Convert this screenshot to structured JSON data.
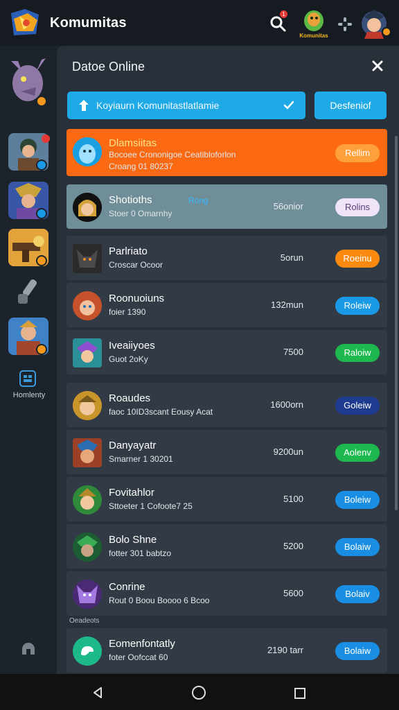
{
  "header": {
    "title": "Komumitas",
    "notification_count": "1",
    "game_logo_text": "Komunitas"
  },
  "sidebar": {
    "label": "Homlenty"
  },
  "panel": {
    "title": "Datoe Online",
    "search_text": "Koyiaurn Komunitastlatlamie",
    "search_button": "Desfeniof"
  },
  "rows": [
    {
      "name": "Dlamsiitas",
      "sub": "Bocoee Crononigoe Ceatibloforlon",
      "sub2": "Croang 01 80237",
      "meta": "",
      "button": "Rellim",
      "button_color": "#ffa13a"
    },
    {
      "name": "Shotioths",
      "sub": "Stoer 0 Omarnhy",
      "tag": "Rong",
      "meta": "56onior",
      "button": "Rolins",
      "button_color": "#efe3f7"
    },
    {
      "name": "Parlriato",
      "sub": "Croscar Ocoor",
      "meta": "5orun",
      "button": "Roeinu",
      "button_color": "#fb8a10"
    },
    {
      "name": "Roonuoiuns",
      "sub": "foier 1390",
      "meta": "132mun",
      "button": "Roleiw",
      "button_color": "#1a9ae6"
    },
    {
      "name": "Iveaiiyoes",
      "sub": "Guot 2oKy",
      "meta": "7500",
      "button": "Raloiw",
      "button_color": "#1db94f"
    },
    {
      "name": "Roaudes",
      "sub": "faoc 10ID3scant Eousy Acat",
      "meta": "1600orn",
      "button": "Goleiw",
      "button_color": "#1e3c8f"
    },
    {
      "name": "Danyayatr",
      "sub": "Smarner 1 30201",
      "meta": "9200un",
      "button": "Aolenv",
      "button_color": "#1db94f"
    },
    {
      "name": "Fovitahlor",
      "sub": "Sttoeter 1 Cofoote7 25",
      "meta": "5100",
      "button": "Boleiw",
      "button_color": "#1a8ee3"
    },
    {
      "name": "Bolo Shne",
      "sub": "fotter 301 babtzo",
      "meta": "5200",
      "button": "Bolaiw",
      "button_color": "#1a8ee3"
    },
    {
      "name": "Conrine",
      "sub": "Rout 0 Boou Boooo 6 Bcoo",
      "meta": "5600",
      "button": "Bolaiv",
      "button_color": "#1a8ee3"
    },
    {
      "name": "Eomenfontatly",
      "sub": "foter Oofccat 60",
      "meta": "2190 tarr",
      "button": "Bolaiw",
      "button_color": "#1a8ee3"
    }
  ],
  "section_label": "Oeadeots",
  "colors": {
    "accent": "#1fa9e6",
    "highlight_row": "#fb6a12",
    "selected_row": "#6f8e98",
    "panel": "#283039",
    "row": "#323b45"
  }
}
